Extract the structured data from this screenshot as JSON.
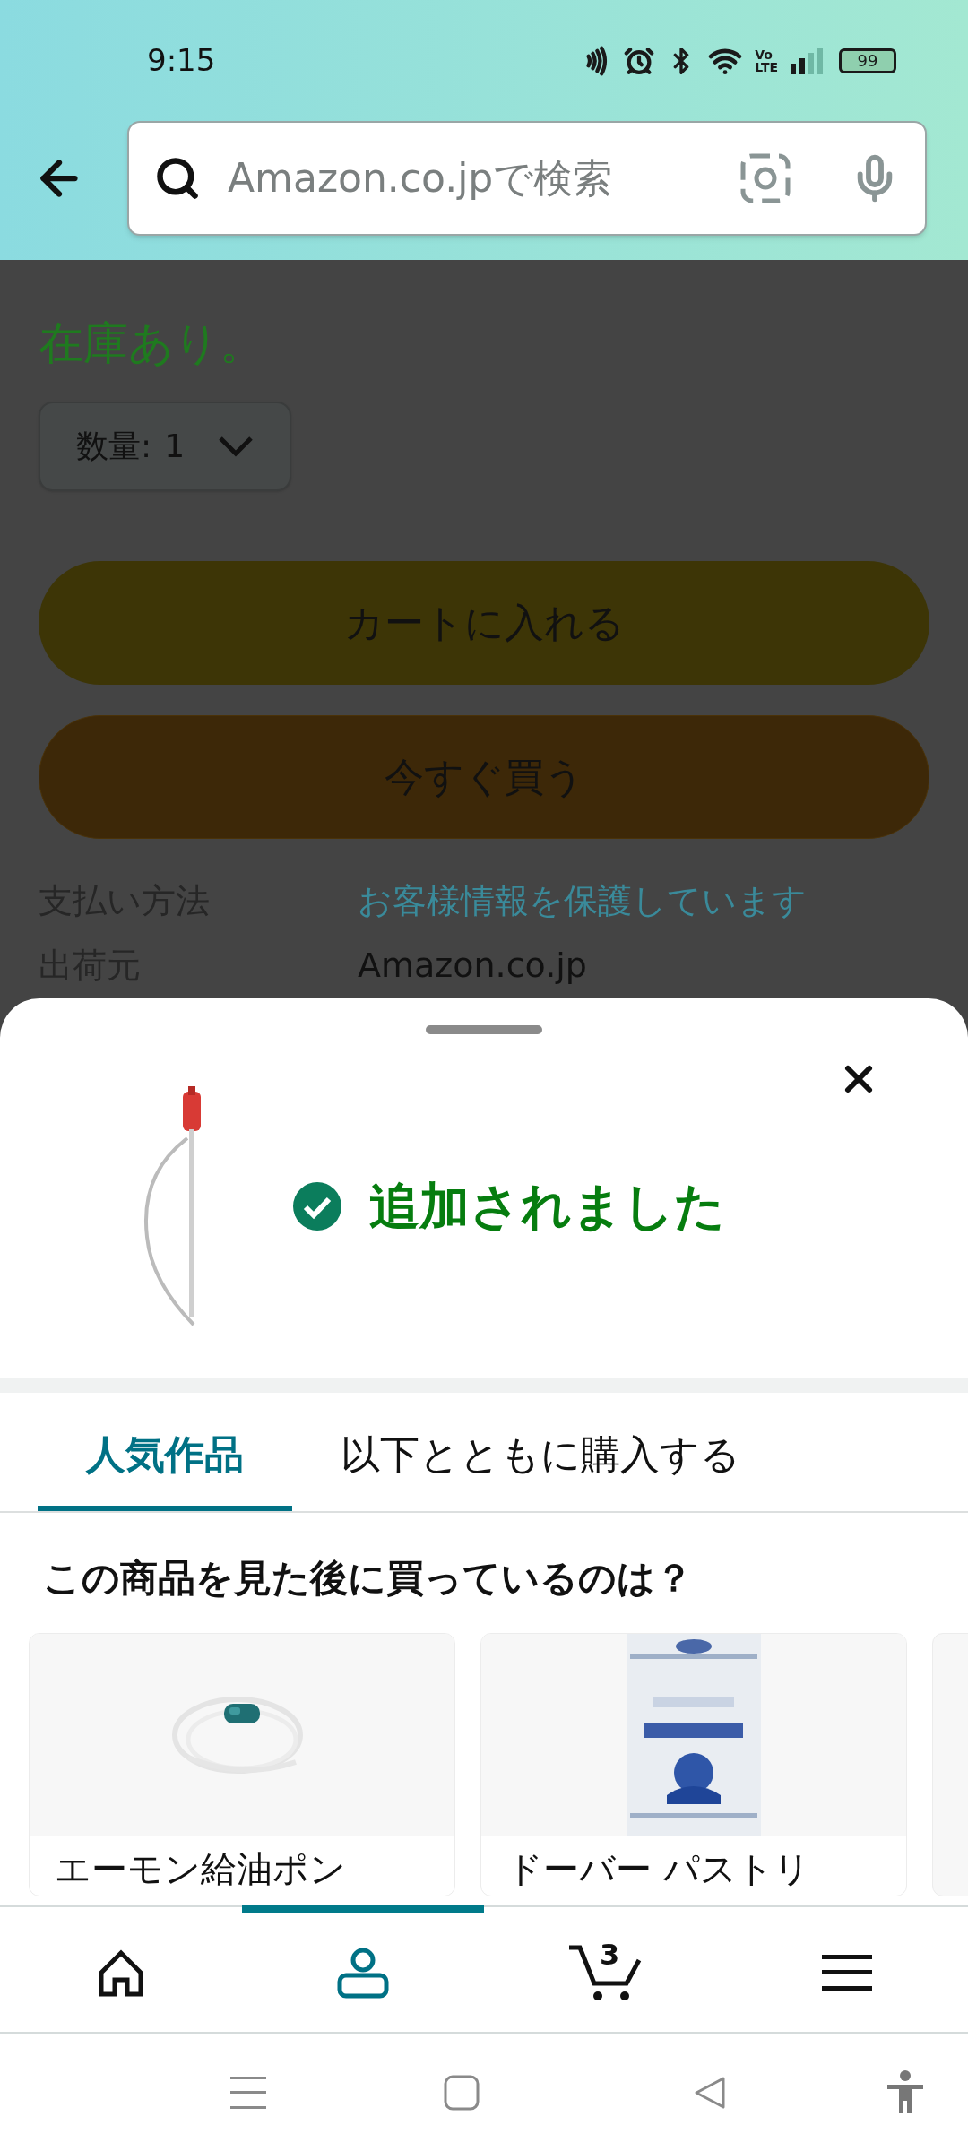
{
  "status_bar": {
    "time": "9:15",
    "volte": [
      "Vo",
      "LTE"
    ],
    "battery": "99"
  },
  "search": {
    "placeholder": "Amazon.co.jpで検索"
  },
  "product_page": {
    "stock": "在庫あり。",
    "quantity": {
      "label": "数量:",
      "value": "1"
    },
    "buttons": [
      {
        "label": "カートに入れる",
        "kind": "cart"
      },
      {
        "label": "今すぐ買う",
        "kind": "buy"
      }
    ],
    "info_rows": [
      {
        "label": "支払い方法",
        "value": "お客様情報を保護しています",
        "kind": "link"
      },
      {
        "label": "出荷元",
        "value": "Amazon.co.jp",
        "kind": "text"
      }
    ]
  },
  "sheet": {
    "confirmation": "追加されました",
    "tabs": [
      {
        "label": "人気作品",
        "selected": true
      },
      {
        "label": "以下とともに購入する",
        "selected": false
      }
    ],
    "heading": "この商品を見た後に買っているのは？",
    "products": [
      {
        "title": "エーモン給油ポン",
        "kind": "hose"
      },
      {
        "title": "ドーバー パストリ",
        "kind": "can"
      }
    ]
  },
  "bottom_nav": [
    {
      "kind": "home",
      "selected": false
    },
    {
      "kind": "account",
      "selected": true
    },
    {
      "kind": "cart",
      "selected": false,
      "count": "3"
    },
    {
      "kind": "menu",
      "selected": false
    }
  ]
}
